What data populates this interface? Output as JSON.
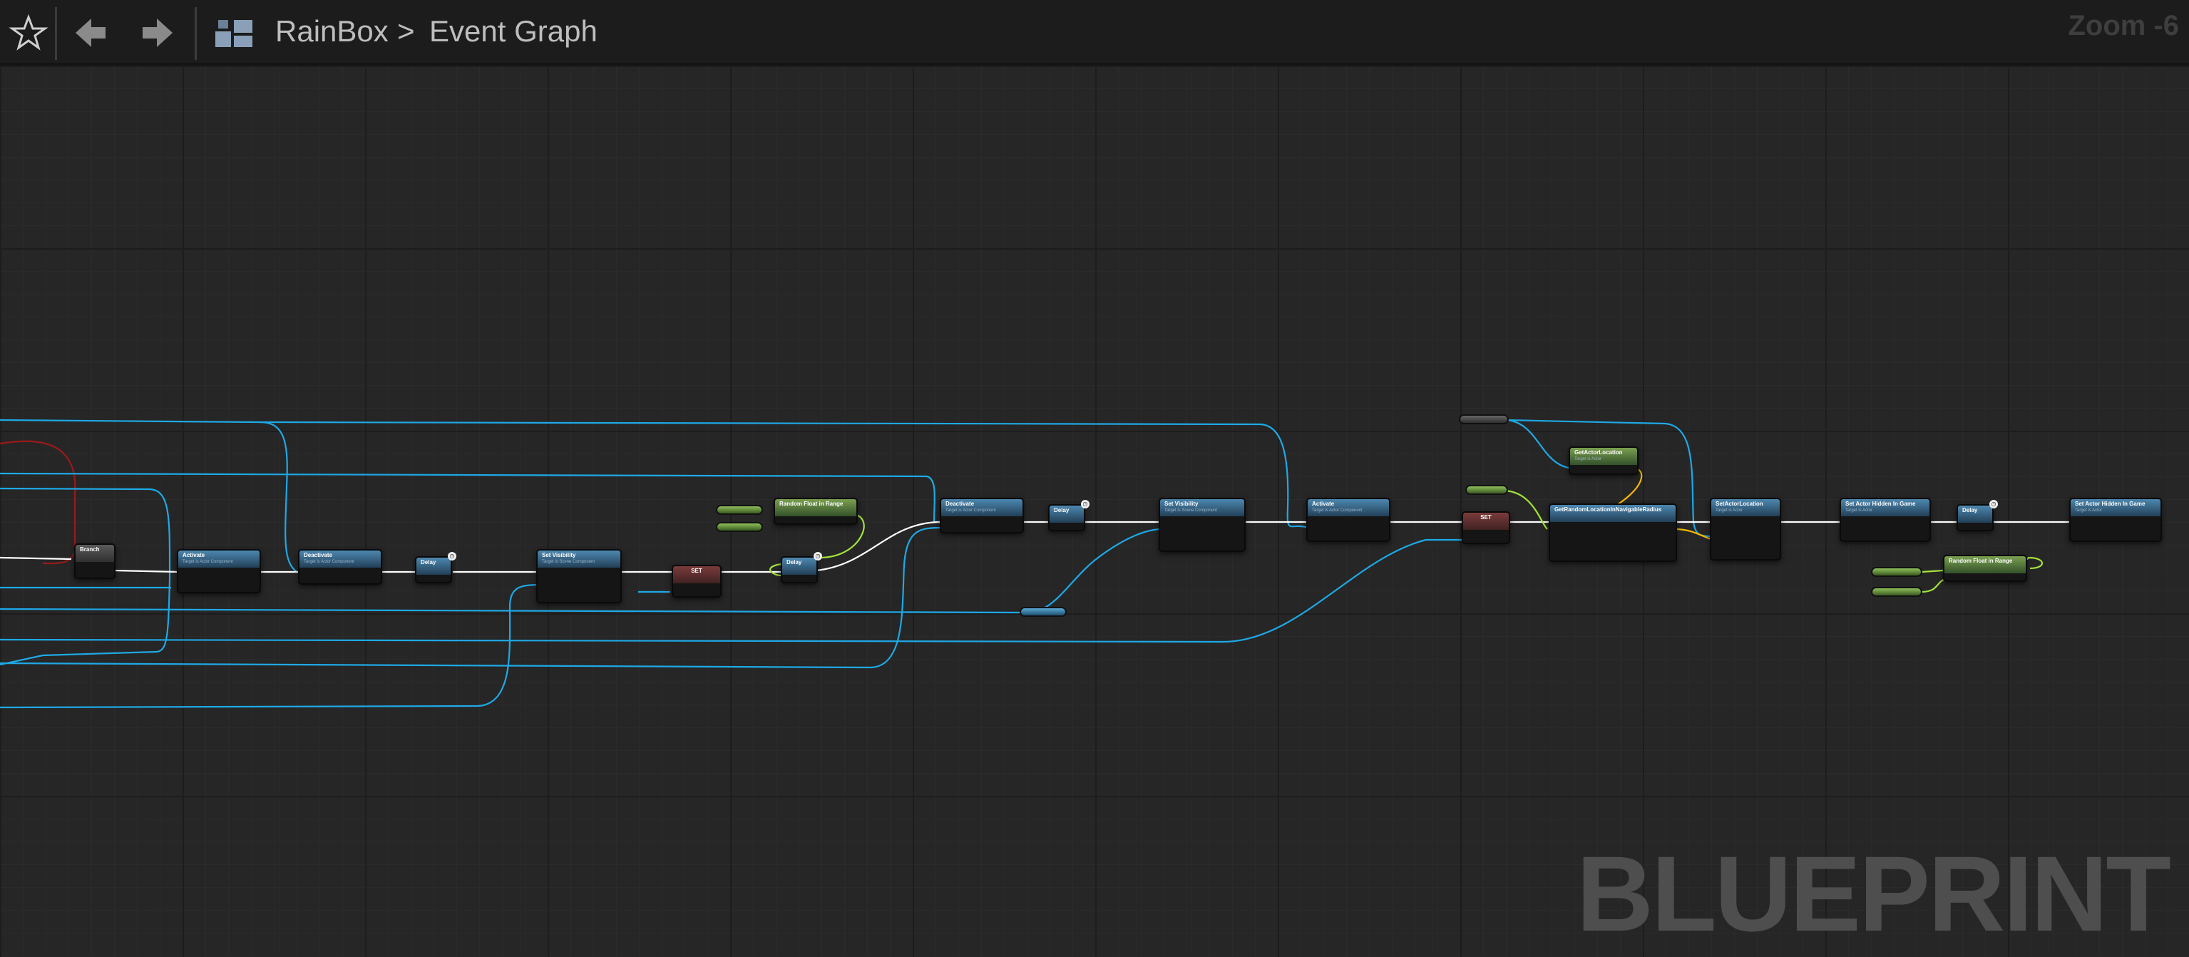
{
  "toolbar": {
    "favorite_icon": "star-icon",
    "back_icon": "arrow-left-icon",
    "forward_icon": "arrow-right-icon",
    "blueprint_icon": "blueprint-graph-icon",
    "breadcrumb": {
      "asset": "RainBox",
      "separator": ">",
      "graph": "Event Graph"
    },
    "zoom": "Zoom -6"
  },
  "graph": {
    "watermark": "BLUEPRINT",
    "colors": {
      "exec": "#ffffff",
      "object_wire": "#1ea9e6",
      "float_wire": "#a4e23a",
      "vector_wire": "#f5b800",
      "error_wire": "#a01818"
    },
    "nodes": [
      {
        "id": "branch",
        "title": "Branch",
        "kind": "branch"
      },
      {
        "id": "activate1",
        "title": "Activate",
        "subtitle": "Target is Actor Component",
        "kind": "function"
      },
      {
        "id": "deactivate1",
        "title": "Deactivate",
        "subtitle": "Target is Actor Component",
        "kind": "function"
      },
      {
        "id": "delay1",
        "title": "Delay",
        "kind": "function",
        "badge": "◷"
      },
      {
        "id": "setvis1",
        "title": "Set Visibility",
        "subtitle": "Target is Scene Component",
        "kind": "function"
      },
      {
        "id": "set1",
        "title": "SET",
        "kind": "set"
      },
      {
        "id": "randfloat1",
        "title": "Random Float in Range",
        "kind": "pure"
      },
      {
        "id": "delay2",
        "title": "Delay",
        "kind": "function",
        "badge": "◷"
      },
      {
        "id": "deactivate2",
        "title": "Deactivate",
        "subtitle": "Target is Actor Component",
        "kind": "function"
      },
      {
        "id": "delay3",
        "title": "Delay",
        "kind": "function",
        "badge": "◷"
      },
      {
        "id": "setvis2",
        "title": "Set Visibility",
        "subtitle": "Target is Scene Component",
        "kind": "function"
      },
      {
        "id": "activate2",
        "title": "Activate",
        "subtitle": "Target is Actor Component",
        "kind": "function"
      },
      {
        "id": "set2",
        "title": "SET",
        "kind": "set"
      },
      {
        "id": "getactorloc1",
        "title": "GetActorLocation",
        "subtitle": "Target is Actor",
        "kind": "pure"
      },
      {
        "id": "getrandomloc",
        "title": "GetRandomLocationInNavigableRadius",
        "kind": "function"
      },
      {
        "id": "setactorloc",
        "title": "SetActorLocation",
        "subtitle": "Target is Actor",
        "kind": "function"
      },
      {
        "id": "hidden1",
        "title": "Set Actor Hidden In Game",
        "subtitle": "Target is Actor",
        "kind": "function"
      },
      {
        "id": "delay4",
        "title": "Delay",
        "kind": "function",
        "badge": "◷"
      },
      {
        "id": "randfloat2",
        "title": "Random Float in Range",
        "kind": "pure"
      },
      {
        "id": "hidden2",
        "title": "Set Actor Hidden In Game",
        "subtitle": "Target is Actor",
        "kind": "function"
      }
    ]
  }
}
